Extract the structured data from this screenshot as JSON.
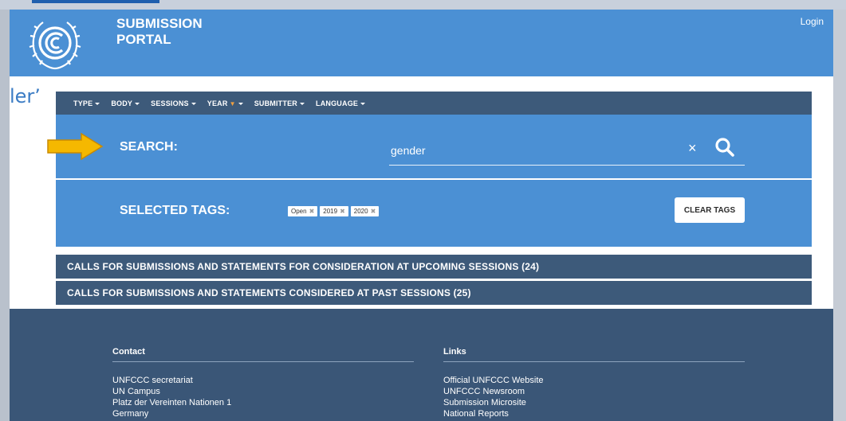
{
  "header": {
    "title_line1": "SUBMISSION",
    "title_line2": "PORTAL",
    "login": "Login"
  },
  "ghost_text": "ler’",
  "filters": [
    {
      "label": "TYPE"
    },
    {
      "label": "BODY"
    },
    {
      "label": "SESSIONS"
    },
    {
      "label": "YEAR"
    },
    {
      "label": "SUBMITTER"
    },
    {
      "label": "LANGUAGE"
    }
  ],
  "search": {
    "label": "SEARCH:",
    "value": "gender",
    "clear_symbol": "×"
  },
  "tags": {
    "label": "SELECTED TAGS:",
    "items": [
      "Open",
      "2019",
      "2020"
    ],
    "remove_symbol": "✖",
    "clear_button": "CLEAR TAGS"
  },
  "sections": [
    {
      "label": "CALLS FOR SUBMISSIONS AND STATEMENTS FOR CONSIDERATION AT UPCOMING SESSIONS (24)"
    },
    {
      "label": "CALLS FOR SUBMISSIONS AND STATEMENTS CONSIDERED AT PAST SESSIONS (25)"
    }
  ],
  "footer": {
    "contact": {
      "title": "Contact",
      "lines": [
        "UNFCCC secretariat",
        "UN Campus",
        "Platz der Vereinten Nationen 1",
        "Germany"
      ]
    },
    "links": {
      "title": "Links",
      "items": [
        "Official UNFCCC Website",
        "UNFCCC Newsroom",
        "Submission Microsite",
        "National Reports"
      ]
    }
  },
  "colors": {
    "header_blue": "#4b90d4",
    "nav_dark": "#3d5a7a",
    "footer_dark": "#3a5677",
    "arrow_yellow": "#f5b800"
  }
}
